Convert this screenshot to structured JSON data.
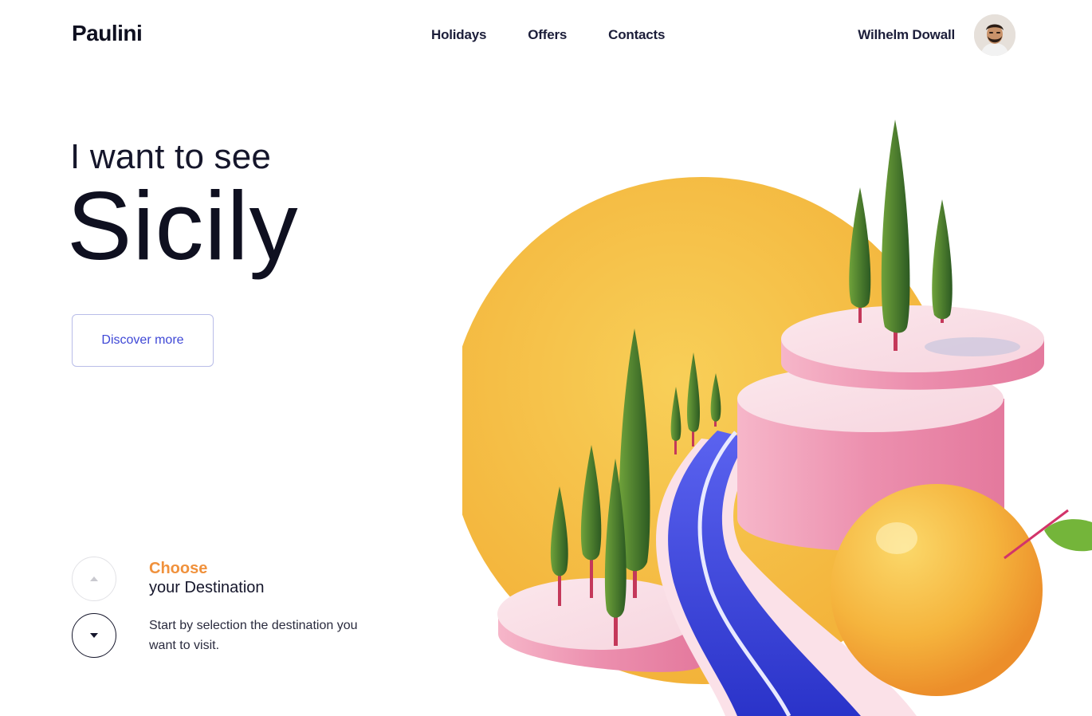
{
  "brand": {
    "logo": "Paulini"
  },
  "nav": {
    "items": [
      "Holidays",
      "Offers",
      "Contacts"
    ]
  },
  "user": {
    "name": "Wilhelm Dowall"
  },
  "hero": {
    "pretitle": "I want to see",
    "title": "Sicily",
    "cta_label": "Discover more"
  },
  "destination": {
    "highlight": "Choose",
    "subtitle": "your Destination",
    "description": "Start by selection the destination you want to visit."
  },
  "colors": {
    "accent_orange": "#f0913c",
    "link_blue": "#3f48d6",
    "sun_yellow": "#f6c64a",
    "pink": "#ee9bb6",
    "river_blue": "#3a44e0",
    "tree_green": "#3f7a2a"
  }
}
